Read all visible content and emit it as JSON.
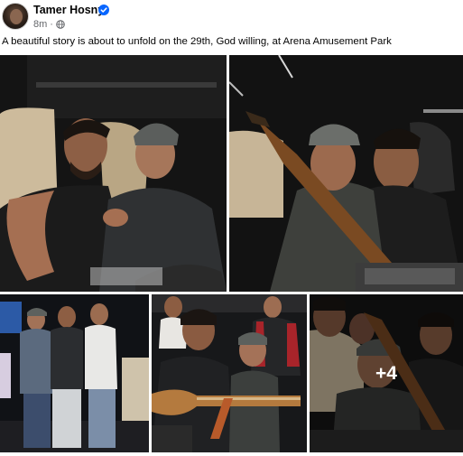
{
  "post": {
    "author": "Tamer Hosny",
    "time": "8m",
    "separator": "·",
    "caption": "A beautiful story is about to unfold on the 29th, God willing, at Arena Amusement Park",
    "icons": {
      "verified": "verified-badge-icon",
      "audience": "globe-icon"
    },
    "colors": {
      "verified": "#0866ff",
      "meta": "#65676b"
    }
  },
  "gallery": {
    "photos": [
      {
        "id": "photo-1"
      },
      {
        "id": "photo-2"
      },
      {
        "id": "photo-3"
      },
      {
        "id": "photo-4"
      },
      {
        "id": "photo-5",
        "more_label": "+4"
      }
    ]
  }
}
